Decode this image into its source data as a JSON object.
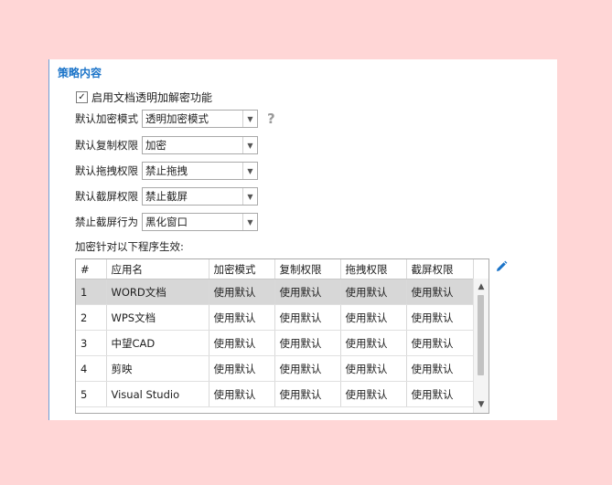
{
  "section_title": "策略内容",
  "enable_checkbox": {
    "label": "启用文档透明加解密功能",
    "checked": true,
    "mark": "✓"
  },
  "form": [
    {
      "label": "默认加密模式",
      "value": "透明加密模式",
      "help": true
    },
    {
      "label": "默认复制权限",
      "value": "加密"
    },
    {
      "label": "默认拖拽权限",
      "value": "禁止拖拽"
    },
    {
      "label": "默认截屏权限",
      "value": "禁止截屏"
    },
    {
      "label": "禁止截屏行为",
      "value": "黑化窗口"
    }
  ],
  "help_glyph": "?",
  "apply_label": "加密针对以下程序生效:",
  "table": {
    "headers": [
      "#",
      "应用名",
      "加密模式",
      "复制权限",
      "拖拽权限",
      "截屏权限"
    ],
    "rows": [
      [
        "1",
        "WORD文档",
        "使用默认",
        "使用默认",
        "使用默认",
        "使用默认"
      ],
      [
        "2",
        "WPS文档",
        "使用默认",
        "使用默认",
        "使用默认",
        "使用默认"
      ],
      [
        "3",
        "中望CAD",
        "使用默认",
        "使用默认",
        "使用默认",
        "使用默认"
      ],
      [
        "4",
        "剪映",
        "使用默认",
        "使用默认",
        "使用默认",
        "使用默认"
      ],
      [
        "5",
        "Visual Studio",
        "使用默认",
        "使用默认",
        "使用默认",
        "使用默认"
      ]
    ],
    "selected_row": 0
  },
  "icons": {
    "dropdown": "chevron-down-icon",
    "edit": "pencil-icon",
    "help": "question-icon"
  },
  "colors": {
    "accent": "#1a73c8",
    "background": "#ffd6d6",
    "selected_row": "#d7d7d7"
  }
}
